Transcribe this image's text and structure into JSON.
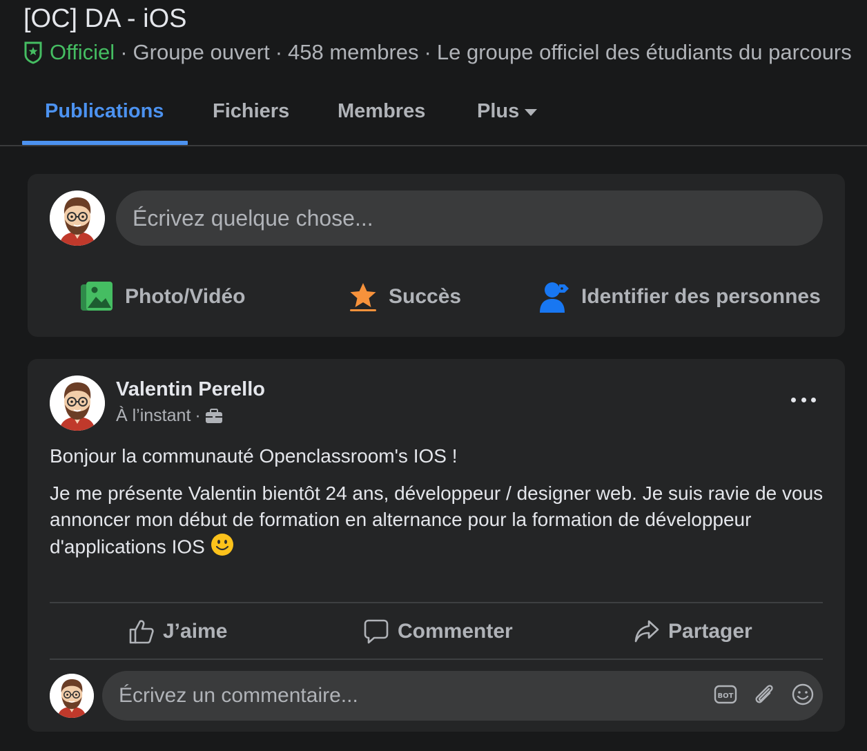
{
  "group": {
    "title": "[OC] DA - iOS",
    "official_label": "Officiel",
    "separator": "·",
    "privacy": "Groupe ouvert",
    "members": "458 membres",
    "description": "Le groupe officiel des étudiants du parcours"
  },
  "tabs": [
    {
      "label": "Publications",
      "active": true
    },
    {
      "label": "Fichiers",
      "active": false
    },
    {
      "label": "Membres",
      "active": false
    },
    {
      "label": "Plus",
      "active": false
    }
  ],
  "composer": {
    "placeholder": "Écrivez quelque chose...",
    "actions": [
      {
        "label": "Photo/Vidéo",
        "icon": "photo-video-icon"
      },
      {
        "label": "Succès",
        "icon": "star-success-icon"
      },
      {
        "label": "Identifier des personnes",
        "icon": "tag-people-icon"
      }
    ]
  },
  "post": {
    "author": "Valentin Perello",
    "timestamp": "À l’instant",
    "separator": "·",
    "audience_icon": "briefcase-icon",
    "paragraphs": [
      "Bonjour la communauté Openclassroom's IOS !",
      "Je me présente Valentin bientôt 24 ans, développeur / designer web. Je suis ravie de vous annoncer mon début de formation en alternance pour la formation de développeur d'applications IOS"
    ],
    "emoji": "🙂",
    "actions": [
      {
        "label": "J’aime",
        "icon": "thumbs-up-icon"
      },
      {
        "label": "Commenter",
        "icon": "comment-icon"
      },
      {
        "label": "Partager",
        "icon": "share-icon"
      }
    ],
    "comment_placeholder": "Écrivez un commentaire...",
    "comment_tools": [
      "bot-icon",
      "paperclip-icon",
      "smiley-icon"
    ]
  },
  "colors": {
    "background": "#18191a",
    "card": "#242526",
    "input": "#3a3b3c",
    "accent": "#4c92f0",
    "official": "#45bd62",
    "text_primary": "#e4e6eb",
    "text_secondary": "#b0b3b8"
  }
}
